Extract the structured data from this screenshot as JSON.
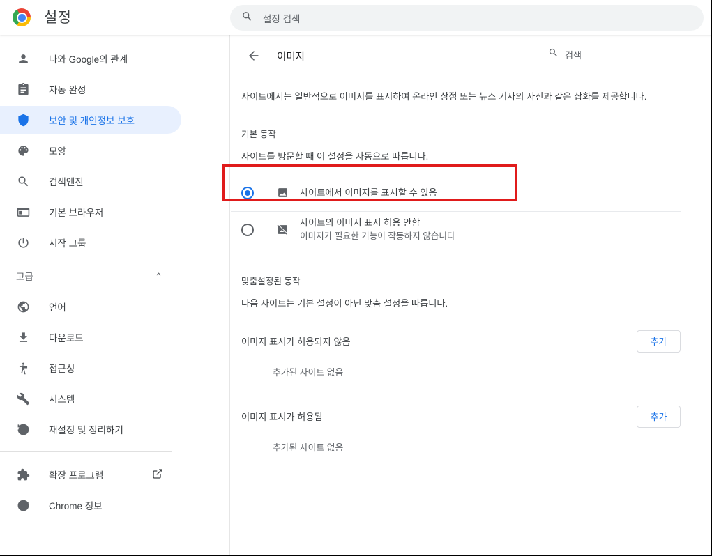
{
  "window": {
    "app_title": "설정",
    "brand_icon": "chrome-logo"
  },
  "global_search": {
    "placeholder": "설정 검색",
    "icon": "search-icon",
    "value": ""
  },
  "sidebar": {
    "items": [
      {
        "label": "나와 Google의 관계",
        "icon": "person-icon",
        "active": false
      },
      {
        "label": "자동 완성",
        "icon": "clipboard-icon",
        "active": false
      },
      {
        "label": "보안 및 개인정보 보호",
        "icon": "shield-icon",
        "active": true
      },
      {
        "label": "모양",
        "icon": "palette-icon",
        "active": false
      },
      {
        "label": "검색엔진",
        "icon": "search-icon",
        "active": false
      },
      {
        "label": "기본 브라우저",
        "icon": "browser-window-icon",
        "active": false
      },
      {
        "label": "시작 그룹",
        "icon": "power-icon",
        "active": false
      }
    ],
    "advanced_section": {
      "label": "고급",
      "expand_icon": "chevron-up-icon",
      "items": [
        {
          "label": "언어",
          "icon": "globe-icon"
        },
        {
          "label": "다운로드",
          "icon": "download-icon"
        },
        {
          "label": "접근성",
          "icon": "accessibility-icon"
        },
        {
          "label": "시스템",
          "icon": "wrench-icon"
        },
        {
          "label": "재설정 및 정리하기",
          "icon": "history-restore-icon"
        }
      ]
    },
    "footer_items": [
      {
        "label": "확장 프로그램",
        "icon": "puzzle-icon",
        "trailing_icon": "open-in-new-icon"
      },
      {
        "label": "Chrome 정보",
        "icon": "chrome-outline-icon",
        "trailing_icon": ""
      }
    ]
  },
  "main": {
    "back_icon": "arrow-left-icon",
    "page_title": "이미지",
    "inner_search": {
      "placeholder": "검색",
      "icon": "search-icon",
      "value": ""
    },
    "description": "사이트에서는 일반적으로 이미지를 표시하여 온라인 상점 또는 뉴스 기사의 사진과 같은 삽화를 제공합니다.",
    "default_behavior": {
      "title": "기본 동작",
      "subtitle": "사이트를 방문할 때 이 설정을 자동으로 따릅니다.",
      "options": [
        {
          "label": "사이트에서 이미지를 표시할 수 있음",
          "sublabel": "",
          "icon": "image-icon",
          "selected": true,
          "highlighted": true
        },
        {
          "label": "사이트의 이미지 표시 허용 안함",
          "sublabel": "이미지가 필요한 기능이 작동하지 않습니다",
          "icon": "image-off-icon",
          "selected": false,
          "highlighted": false
        }
      ]
    },
    "custom_behavior": {
      "title": "맞춤설정된 동작",
      "subtitle": "다음 사이트는 기본 설정이 아닌 맞춤 설정을 따릅니다.",
      "groups": [
        {
          "label": "이미지 표시가 허용되지 않음",
          "add_button": "추가",
          "empty_text": "추가된 사이트 없음"
        },
        {
          "label": "이미지 표시가 허용됨",
          "add_button": "추가",
          "empty_text": "추가된 사이트 없음"
        }
      ]
    }
  },
  "annotation": {
    "color": "#e01b1b",
    "target": "사이트에서 이미지를 표시할 수 있음"
  }
}
